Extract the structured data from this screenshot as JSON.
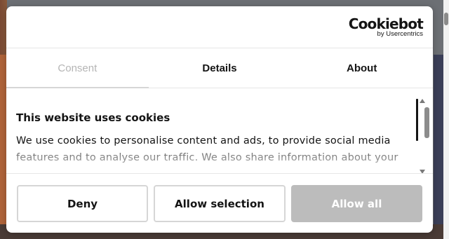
{
  "brand": {
    "name": "Cookiebot",
    "sub": "by Usercentrics"
  },
  "tabs": [
    {
      "label": "Consent",
      "active": true
    },
    {
      "label": "Details",
      "active": false
    },
    {
      "label": "About",
      "active": false
    }
  ],
  "content": {
    "title": "This website uses cookies",
    "body": "We use cookies to personalise content and ads, to provide social media features and to analyse our traffic. We also share information about your"
  },
  "buttons": {
    "deny": "Deny",
    "allow_selection": "Allow selection",
    "allow_all": "Allow all"
  },
  "colors": {
    "disabled_button": "#bcbcbc",
    "text": "#141414"
  }
}
